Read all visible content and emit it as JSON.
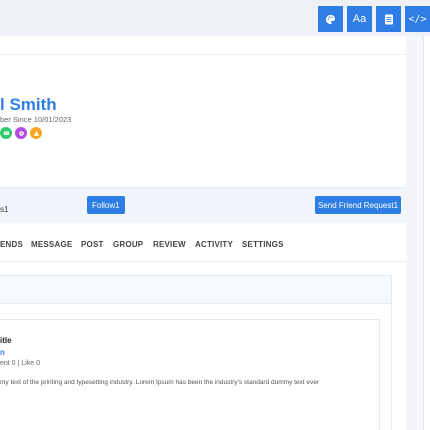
{
  "toolbar": {
    "icons": [
      "palette-icon",
      "font-size-icon",
      "document-icon",
      "code-icon"
    ],
    "font_label": "Aa",
    "code_label": "</>"
  },
  "profile": {
    "name": "l Smith",
    "member_since": "ber Since 10/01/2023",
    "badges": [
      {
        "icon": "chat-icon",
        "color": "#2ecc71"
      },
      {
        "icon": "gear-icon",
        "color": "#b44be0"
      },
      {
        "icon": "warning-icon",
        "color": "#f5a623"
      }
    ]
  },
  "actions": {
    "count_text": "s1",
    "follow_label": "Follow1",
    "friend_request_label": "Send Friend Request1"
  },
  "tabs": [
    "ENDS",
    "MESSAGE",
    "POST",
    "GROUP",
    "REVIEW",
    "ACTIVITY",
    "SETTINGS"
  ],
  "post": {
    "title": "itle",
    "author": "n",
    "stats": "ent 0 | Like 0",
    "body": "my text of the printing and typesetting industry. Lorem Ipsum has been the industry's standard dummy text ever"
  },
  "colors": {
    "accent": "#2f7ee6",
    "topbar_bg": "#eef1f6",
    "action_bar_bg": "#f1f6fc"
  }
}
